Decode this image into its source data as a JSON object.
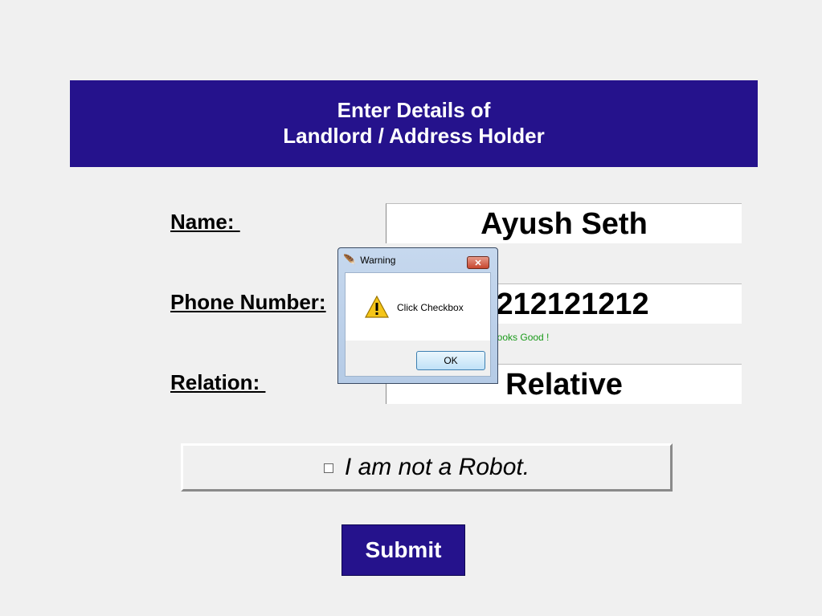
{
  "header": {
    "line1": "Enter Details of",
    "line2": "Landlord / Address Holder"
  },
  "form": {
    "name_label": "Name: ",
    "name_value": "Ayush Seth",
    "phone_label": "Phone Number:",
    "phone_value": "9212121212",
    "phone_status": "Looks Good !",
    "relation_label": "Relation: ",
    "relation_value": "Relative"
  },
  "robot_check": {
    "label": "I am not a Robot.",
    "checked": false
  },
  "submit_label": "Submit",
  "dialog": {
    "title": "Warning",
    "message": "Click Checkbox",
    "ok_label": "OK",
    "icon": "warning-icon",
    "title_icon": "feather-icon"
  },
  "colors": {
    "accent": "#25128c",
    "status_ok": "#1a9a1a"
  }
}
